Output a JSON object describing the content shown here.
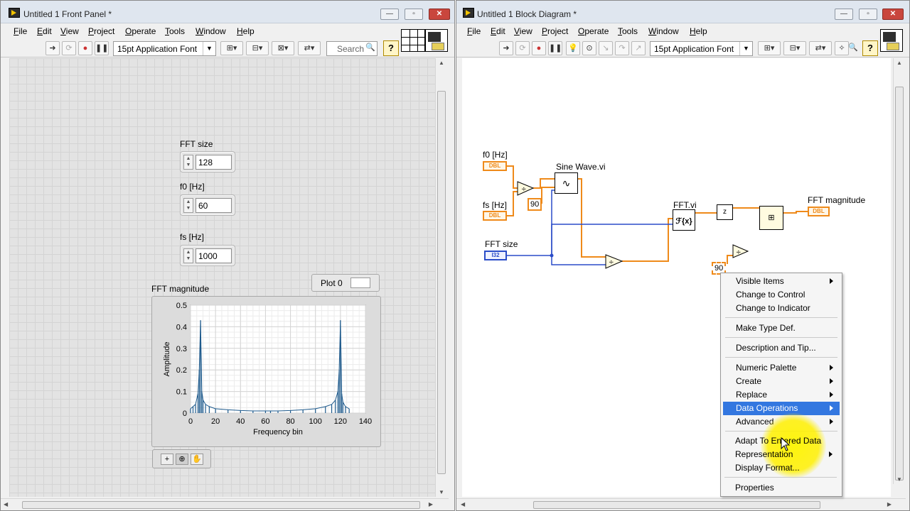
{
  "front_panel": {
    "title": "Untitled 1 Front Panel *",
    "menu": [
      "File",
      "Edit",
      "View",
      "Project",
      "Operate",
      "Tools",
      "Window",
      "Help"
    ],
    "toolbar": {
      "font": "15pt Application Font",
      "search_placeholder": "Search"
    },
    "controls": [
      {
        "label": "FFT size",
        "value": "128"
      },
      {
        "label": "f0 [Hz]",
        "value": "60"
      },
      {
        "label": "fs [Hz]",
        "value": "1000"
      }
    ],
    "graph": {
      "label": "FFT magnitude",
      "legend_plot": "Plot 0",
      "chart_data": {
        "type": "line",
        "title": "",
        "xlabel": "Frequency bin",
        "ylabel": "Amplitude",
        "xlim": [
          0,
          140
        ],
        "ylim": [
          0,
          0.5
        ],
        "xticks": [
          "0",
          "20",
          "40",
          "60",
          "80",
          "100",
          "120",
          "140"
        ],
        "yticks": [
          "0",
          "0.1",
          "0.2",
          "0.3",
          "0.4",
          "0.5"
        ],
        "series": [
          {
            "x": [
              0,
              2,
              4,
              6,
              7,
              8,
              9,
              10,
              12,
              15,
              20,
              30,
              40,
              50,
              60,
              64,
              70,
              80,
              90,
              100,
              108,
              113,
              116,
              118,
              119,
              120,
              121,
              122,
              124,
              127
            ],
            "values": [
              0.02,
              0.03,
              0.04,
              0.09,
              0.2,
              0.43,
              0.1,
              0.06,
              0.04,
              0.03,
              0.02,
              0.015,
              0.012,
              0.01,
              0.01,
              0.01,
              0.01,
              0.012,
              0.015,
              0.02,
              0.03,
              0.04,
              0.06,
              0.1,
              0.2,
              0.43,
              0.09,
              0.05,
              0.03,
              0.02
            ]
          }
        ],
        "grid": true,
        "color": "#1e5a8c"
      }
    }
  },
  "block_diagram": {
    "title": "Untitled 1 Block Diagram *",
    "menu": [
      "File",
      "Edit",
      "View",
      "Project",
      "Operate",
      "Tools",
      "Window",
      "Help"
    ],
    "toolbar": {
      "font": "15pt Application Font"
    },
    "labels": {
      "f0": "f0 [Hz]",
      "fs": "fs [Hz]",
      "fft_size": "FFT size",
      "sine_wave": "Sine Wave.vi",
      "fft_vi": "FFT.vi",
      "fft_mag": "FFT magnitude"
    },
    "terminals": {
      "dbl": "DBL",
      "i32": "I32"
    },
    "constants": {
      "c1": "90",
      "c2": "90"
    },
    "fft_symbol": "ℱ{x}"
  },
  "context_menu": {
    "items": [
      {
        "label": "Visible Items",
        "submenu": true
      },
      {
        "label": "Change to Control",
        "submenu": false
      },
      {
        "label": "Change to Indicator",
        "submenu": false
      },
      {
        "label": "Make Type Def.",
        "submenu": false
      },
      {
        "label": "Description and Tip...",
        "submenu": false
      },
      {
        "label": "Numeric Palette",
        "submenu": true
      },
      {
        "label": "Create",
        "submenu": true
      },
      {
        "label": "Replace",
        "submenu": true
      },
      {
        "label": "Data Operations",
        "submenu": true,
        "highlighted": true
      },
      {
        "label": "Advanced",
        "submenu": true
      },
      {
        "label": "Adapt To Entered Data",
        "submenu": false
      },
      {
        "label": "Representation",
        "submenu": true
      },
      {
        "label": "Display Format...",
        "submenu": false
      },
      {
        "label": "Properties",
        "submenu": false
      }
    ]
  },
  "colors": {
    "double_wire": "#ef8a1a",
    "int_wire": "#2a4cc8",
    "highlight": "#3377e0"
  }
}
